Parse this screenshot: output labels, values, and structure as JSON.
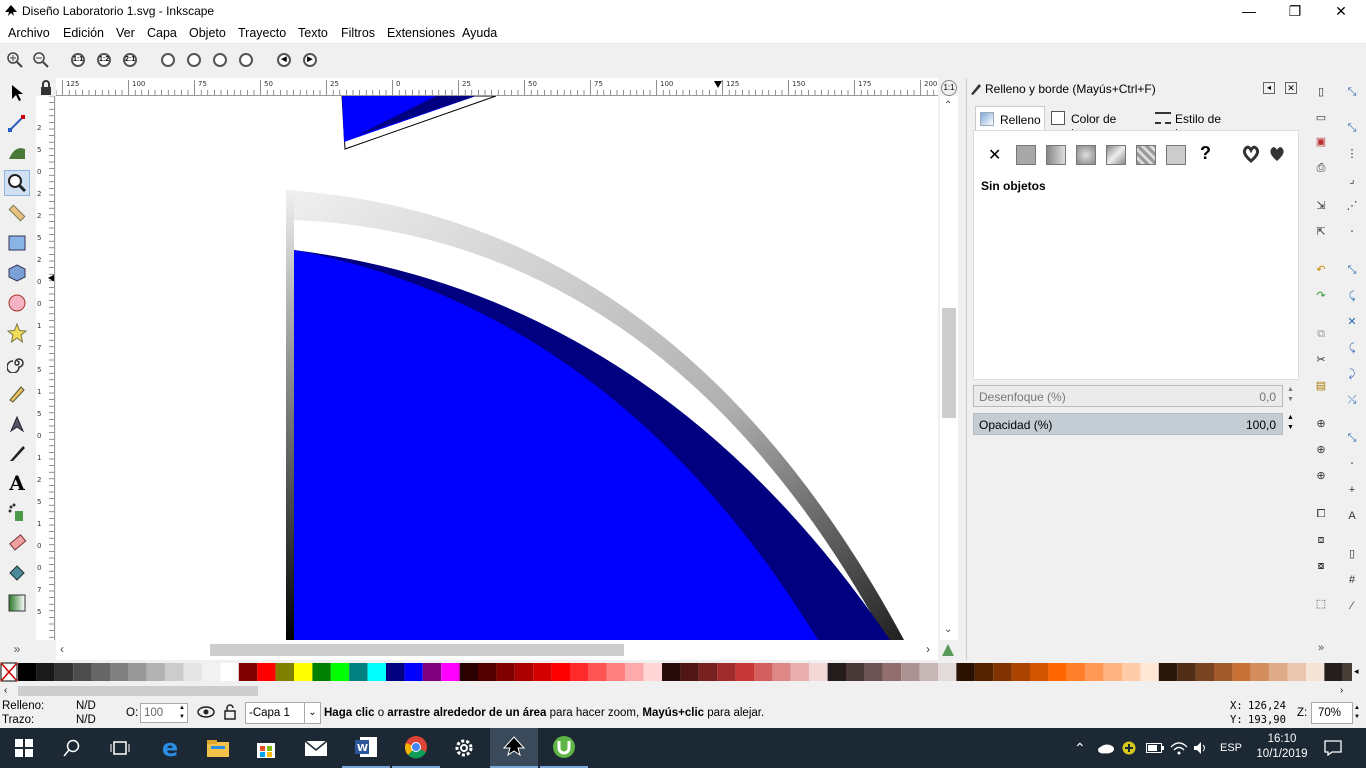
{
  "window": {
    "title": "Diseño Laboratorio 1.svg - Inkscape",
    "minimize": "—",
    "restore": "❐",
    "close": "✕"
  },
  "menu": [
    "Archivo",
    "Edición",
    "Ver",
    "Capa",
    "Objeto",
    "Trayecto",
    "Texto",
    "Filtros",
    "Extensiones",
    "Ayuda"
  ],
  "zoom_buttons": [
    "1:1",
    "1:2",
    "2:1"
  ],
  "ruler": {
    "h_ticks": [
      "125",
      "100",
      "75",
      "50",
      "25",
      "0",
      "25",
      "50",
      "75",
      "100",
      "125",
      "150",
      "175",
      "200"
    ],
    "v_ticks": [
      "2",
      "5",
      "0",
      "2",
      "2",
      "5",
      "2",
      "0",
      "0",
      "1",
      "7",
      "5",
      "1",
      "5",
      "0",
      "1",
      "2",
      "5",
      "1",
      "0",
      "0",
      "7",
      "5"
    ]
  },
  "panel": {
    "title": "Relleno y borde (Mayús+Ctrl+F)",
    "tabs": [
      "Relleno",
      "Color de trazo",
      "Estilo de trazo"
    ],
    "none_symbol": "✕",
    "unknown_symbol": "?",
    "status": "Sin objetos",
    "blur_label": "Desenfoque (%)",
    "blur_value": "0,0",
    "opacity_label": "Opacidad (%)",
    "opacity_value": "100,0",
    "more": "»"
  },
  "toolbox_more": "»",
  "colors": {
    "accent": "#0000ff",
    "dark_blue": "#000080",
    "taskbar": "#1c2834"
  },
  "status": {
    "fill_label": "Relleno:",
    "fill_value": "N/D",
    "stroke_label": "Trazo:",
    "stroke_value": "N/D",
    "opacity_label": "O:",
    "opacity_value": "100",
    "layer": "-Capa 1",
    "message_bold1": "Haga clic",
    "message_mid1": " o ",
    "message_bold2": "arrastre alrededor de un área",
    "message_mid2": " para hacer zoom, ",
    "message_bold3": "Mayús+clic",
    "message_end": " para alejar.",
    "x_label": "X:",
    "x_value": "126,24",
    "y_label": "Y:",
    "y_value": "193,90",
    "z_label": "Z:",
    "z_value": "70%"
  },
  "taskbar": {
    "lang": "ESP",
    "time": "16:10",
    "date": "10/1/2019"
  }
}
